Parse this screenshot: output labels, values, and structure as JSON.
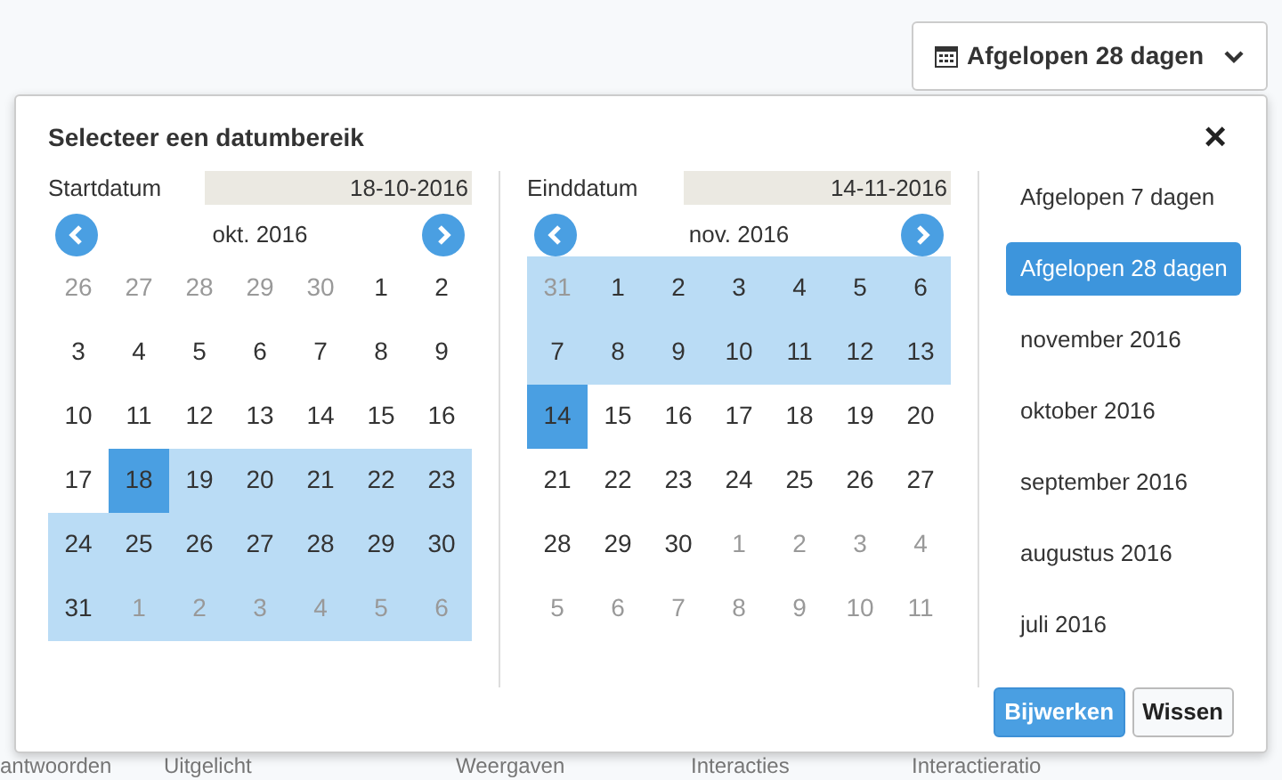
{
  "trigger": {
    "label": "Afgelopen 28 dagen"
  },
  "dialog": {
    "title": "Selecteer een datumbereik",
    "close": "×"
  },
  "calendars": [
    {
      "label": "Startdatum",
      "value": "18-10-2016",
      "month": "okt. 2016",
      "weeks": [
        [
          {
            "day": "26",
            "outside": true,
            "in_range": false,
            "endpoint": false
          },
          {
            "day": "27",
            "outside": true,
            "in_range": false,
            "endpoint": false
          },
          {
            "day": "28",
            "outside": true,
            "in_range": false,
            "endpoint": false
          },
          {
            "day": "29",
            "outside": true,
            "in_range": false,
            "endpoint": false
          },
          {
            "day": "30",
            "outside": true,
            "in_range": false,
            "endpoint": false
          },
          {
            "day": "1",
            "outside": false,
            "in_range": false,
            "endpoint": false
          },
          {
            "day": "2",
            "outside": false,
            "in_range": false,
            "endpoint": false
          }
        ],
        [
          {
            "day": "3",
            "outside": false,
            "in_range": false,
            "endpoint": false
          },
          {
            "day": "4",
            "outside": false,
            "in_range": false,
            "endpoint": false
          },
          {
            "day": "5",
            "outside": false,
            "in_range": false,
            "endpoint": false
          },
          {
            "day": "6",
            "outside": false,
            "in_range": false,
            "endpoint": false
          },
          {
            "day": "7",
            "outside": false,
            "in_range": false,
            "endpoint": false
          },
          {
            "day": "8",
            "outside": false,
            "in_range": false,
            "endpoint": false
          },
          {
            "day": "9",
            "outside": false,
            "in_range": false,
            "endpoint": false
          }
        ],
        [
          {
            "day": "10",
            "outside": false,
            "in_range": false,
            "endpoint": false
          },
          {
            "day": "11",
            "outside": false,
            "in_range": false,
            "endpoint": false
          },
          {
            "day": "12",
            "outside": false,
            "in_range": false,
            "endpoint": false
          },
          {
            "day": "13",
            "outside": false,
            "in_range": false,
            "endpoint": false
          },
          {
            "day": "14",
            "outside": false,
            "in_range": false,
            "endpoint": false
          },
          {
            "day": "15",
            "outside": false,
            "in_range": false,
            "endpoint": false
          },
          {
            "day": "16",
            "outside": false,
            "in_range": false,
            "endpoint": false
          }
        ],
        [
          {
            "day": "17",
            "outside": false,
            "in_range": false,
            "endpoint": false
          },
          {
            "day": "18",
            "outside": false,
            "in_range": true,
            "endpoint": true
          },
          {
            "day": "19",
            "outside": false,
            "in_range": true,
            "endpoint": false
          },
          {
            "day": "20",
            "outside": false,
            "in_range": true,
            "endpoint": false
          },
          {
            "day": "21",
            "outside": false,
            "in_range": true,
            "endpoint": false
          },
          {
            "day": "22",
            "outside": false,
            "in_range": true,
            "endpoint": false
          },
          {
            "day": "23",
            "outside": false,
            "in_range": true,
            "endpoint": false
          }
        ],
        [
          {
            "day": "24",
            "outside": false,
            "in_range": true,
            "endpoint": false
          },
          {
            "day": "25",
            "outside": false,
            "in_range": true,
            "endpoint": false
          },
          {
            "day": "26",
            "outside": false,
            "in_range": true,
            "endpoint": false
          },
          {
            "day": "27",
            "outside": false,
            "in_range": true,
            "endpoint": false
          },
          {
            "day": "28",
            "outside": false,
            "in_range": true,
            "endpoint": false
          },
          {
            "day": "29",
            "outside": false,
            "in_range": true,
            "endpoint": false
          },
          {
            "day": "30",
            "outside": false,
            "in_range": true,
            "endpoint": false
          }
        ],
        [
          {
            "day": "31",
            "outside": false,
            "in_range": true,
            "endpoint": false
          },
          {
            "day": "1",
            "outside": true,
            "in_range": true,
            "endpoint": false
          },
          {
            "day": "2",
            "outside": true,
            "in_range": true,
            "endpoint": false
          },
          {
            "day": "3",
            "outside": true,
            "in_range": true,
            "endpoint": false
          },
          {
            "day": "4",
            "outside": true,
            "in_range": true,
            "endpoint": false
          },
          {
            "day": "5",
            "outside": true,
            "in_range": true,
            "endpoint": false
          },
          {
            "day": "6",
            "outside": true,
            "in_range": true,
            "endpoint": false
          }
        ]
      ]
    },
    {
      "label": "Einddatum",
      "value": "14-11-2016",
      "month": "nov. 2016",
      "weeks": [
        [
          {
            "day": "31",
            "outside": true,
            "in_range": true,
            "endpoint": false
          },
          {
            "day": "1",
            "outside": false,
            "in_range": true,
            "endpoint": false
          },
          {
            "day": "2",
            "outside": false,
            "in_range": true,
            "endpoint": false
          },
          {
            "day": "3",
            "outside": false,
            "in_range": true,
            "endpoint": false
          },
          {
            "day": "4",
            "outside": false,
            "in_range": true,
            "endpoint": false
          },
          {
            "day": "5",
            "outside": false,
            "in_range": true,
            "endpoint": false
          },
          {
            "day": "6",
            "outside": false,
            "in_range": true,
            "endpoint": false
          }
        ],
        [
          {
            "day": "7",
            "outside": false,
            "in_range": true,
            "endpoint": false
          },
          {
            "day": "8",
            "outside": false,
            "in_range": true,
            "endpoint": false
          },
          {
            "day": "9",
            "outside": false,
            "in_range": true,
            "endpoint": false
          },
          {
            "day": "10",
            "outside": false,
            "in_range": true,
            "endpoint": false
          },
          {
            "day": "11",
            "outside": false,
            "in_range": true,
            "endpoint": false
          },
          {
            "day": "12",
            "outside": false,
            "in_range": true,
            "endpoint": false
          },
          {
            "day": "13",
            "outside": false,
            "in_range": true,
            "endpoint": false
          }
        ],
        [
          {
            "day": "14",
            "outside": false,
            "in_range": true,
            "endpoint": true
          },
          {
            "day": "15",
            "outside": false,
            "in_range": false,
            "endpoint": false
          },
          {
            "day": "16",
            "outside": false,
            "in_range": false,
            "endpoint": false
          },
          {
            "day": "17",
            "outside": false,
            "in_range": false,
            "endpoint": false
          },
          {
            "day": "18",
            "outside": false,
            "in_range": false,
            "endpoint": false
          },
          {
            "day": "19",
            "outside": false,
            "in_range": false,
            "endpoint": false
          },
          {
            "day": "20",
            "outside": false,
            "in_range": false,
            "endpoint": false
          }
        ],
        [
          {
            "day": "21",
            "outside": false,
            "in_range": false,
            "endpoint": false
          },
          {
            "day": "22",
            "outside": false,
            "in_range": false,
            "endpoint": false
          },
          {
            "day": "23",
            "outside": false,
            "in_range": false,
            "endpoint": false
          },
          {
            "day": "24",
            "outside": false,
            "in_range": false,
            "endpoint": false
          },
          {
            "day": "25",
            "outside": false,
            "in_range": false,
            "endpoint": false
          },
          {
            "day": "26",
            "outside": false,
            "in_range": false,
            "endpoint": false
          },
          {
            "day": "27",
            "outside": false,
            "in_range": false,
            "endpoint": false
          }
        ],
        [
          {
            "day": "28",
            "outside": false,
            "in_range": false,
            "endpoint": false
          },
          {
            "day": "29",
            "outside": false,
            "in_range": false,
            "endpoint": false
          },
          {
            "day": "30",
            "outside": false,
            "in_range": false,
            "endpoint": false
          },
          {
            "day": "1",
            "outside": true,
            "in_range": false,
            "endpoint": false
          },
          {
            "day": "2",
            "outside": true,
            "in_range": false,
            "endpoint": false
          },
          {
            "day": "3",
            "outside": true,
            "in_range": false,
            "endpoint": false
          },
          {
            "day": "4",
            "outside": true,
            "in_range": false,
            "endpoint": false
          }
        ],
        [
          {
            "day": "5",
            "outside": true,
            "in_range": false,
            "endpoint": false
          },
          {
            "day": "6",
            "outside": true,
            "in_range": false,
            "endpoint": false
          },
          {
            "day": "7",
            "outside": true,
            "in_range": false,
            "endpoint": false
          },
          {
            "day": "8",
            "outside": true,
            "in_range": false,
            "endpoint": false
          },
          {
            "day": "9",
            "outside": true,
            "in_range": false,
            "endpoint": false
          },
          {
            "day": "10",
            "outside": true,
            "in_range": false,
            "endpoint": false
          },
          {
            "day": "11",
            "outside": true,
            "in_range": false,
            "endpoint": false
          }
        ]
      ]
    }
  ],
  "presets": [
    {
      "label": "Afgelopen 7 dagen",
      "selected": false
    },
    {
      "label": "Afgelopen 28 dagen",
      "selected": true
    },
    {
      "label": "november 2016",
      "selected": false
    },
    {
      "label": "oktober 2016",
      "selected": false
    },
    {
      "label": "september 2016",
      "selected": false
    },
    {
      "label": "augustus 2016",
      "selected": false
    },
    {
      "label": "juli 2016",
      "selected": false
    }
  ],
  "buttons": [
    {
      "label": "Bijwerken",
      "kind": "primary"
    },
    {
      "label": "Wissen",
      "kind": "secondary"
    }
  ],
  "background_row": [
    "antwoorden",
    "Uitgelicht",
    "Weergaven",
    "Interacties",
    "Interactieratio"
  ]
}
